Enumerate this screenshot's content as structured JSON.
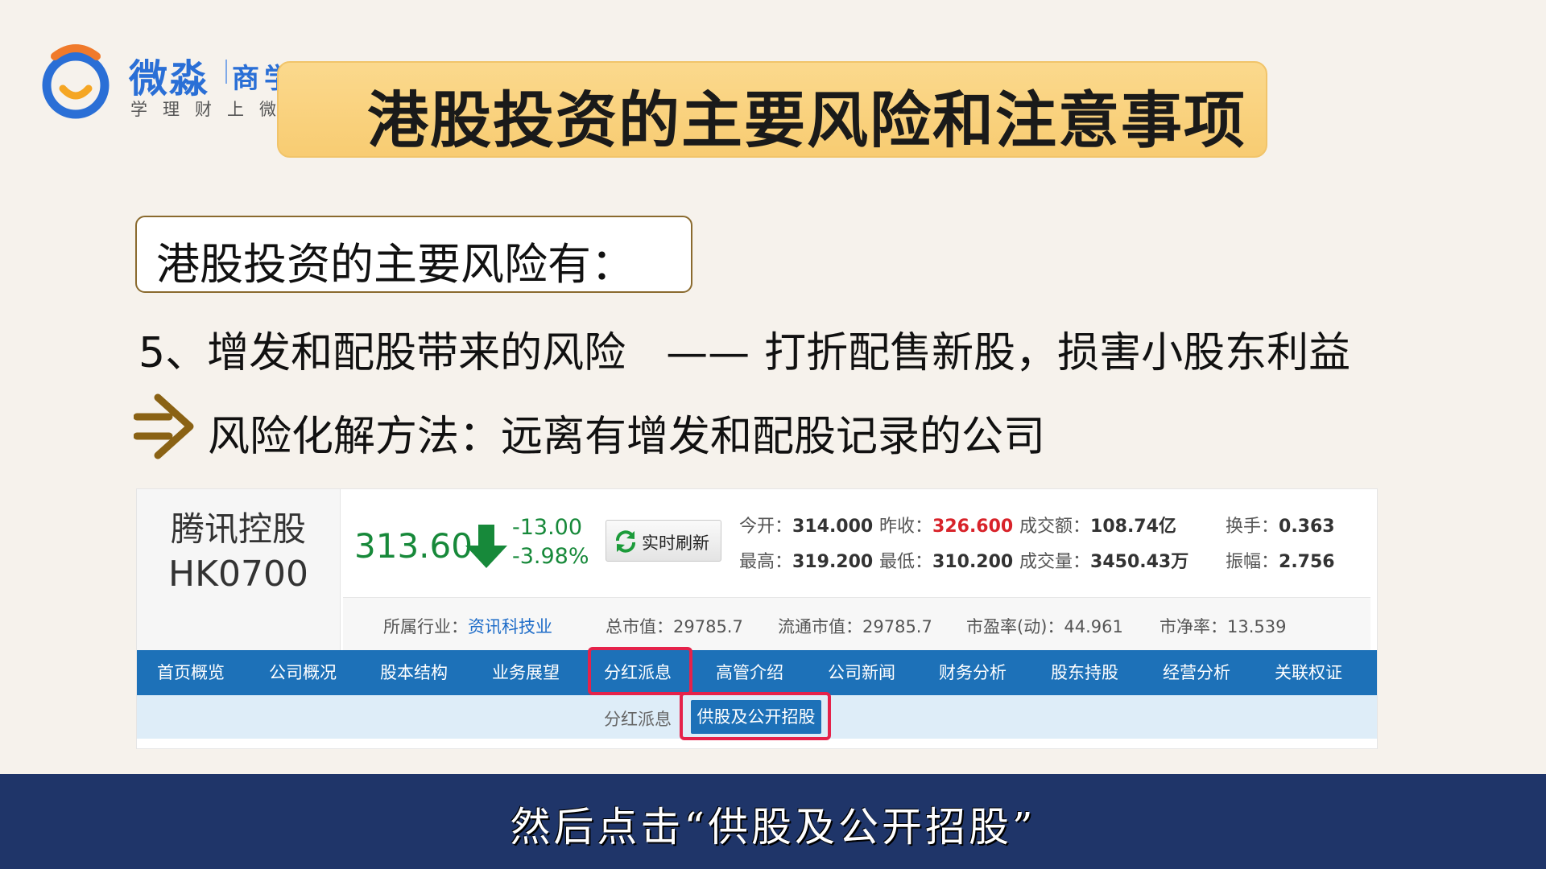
{
  "logo": {
    "brand": "微淼",
    "sub": "商学院",
    "tagline": "学理财上微淼"
  },
  "title": "港股投资的主要风险和注意事项",
  "section_heading": "港股投资的主要风险有：",
  "risk_item": {
    "label": "5、增发和配股带来的风险",
    "dash": "——",
    "desc": "打折配售新股，损害小股东利益"
  },
  "method": "风险化解方法：远离有增发和配股记录的公司",
  "stock": {
    "name": "腾讯控股",
    "code": "HK0700",
    "price": "313.60",
    "change_abs": "-13.00",
    "change_pct": "-3.98%",
    "refresh_label": "实时刷新",
    "quotes": {
      "open_label": "今开：",
      "open": "314.000",
      "prev_close_label": "昨收：",
      "prev_close": "326.600",
      "turnover_label": "成交额：",
      "turnover": "108.74亿",
      "turnover_rate_label": "换手：",
      "turnover_rate": "0.363",
      "high_label": "最高：",
      "high": "319.200",
      "low_label": "最低：",
      "low": "310.200",
      "volume_label": "成交量：",
      "volume": "3450.43万",
      "amplitude_label": "振幅：",
      "amplitude": "2.756"
    },
    "info": {
      "industry_label": "所属行业：",
      "industry": "资讯科技业",
      "total_cap": "总市值：29785.7",
      "float_cap": "流通市值：29785.7",
      "pe": "市盈率(动)：44.961",
      "pb": "市净率：13.539"
    },
    "nav": [
      "首页概览",
      "公司概况",
      "股本结构",
      "业务展望",
      "分红派息",
      "高管介绍",
      "公司新闻",
      "财务分析",
      "股东持股",
      "经营分析",
      "关联权证"
    ],
    "sub_label": "分红派息",
    "sub_button": "供股及公开招股",
    "colors": {
      "up": "#d8232a",
      "down": "#17893a",
      "nav_bg": "#1d71b8",
      "highlight": "#e5224a"
    }
  },
  "subtitle": "然后点击“供股及公开招股”"
}
